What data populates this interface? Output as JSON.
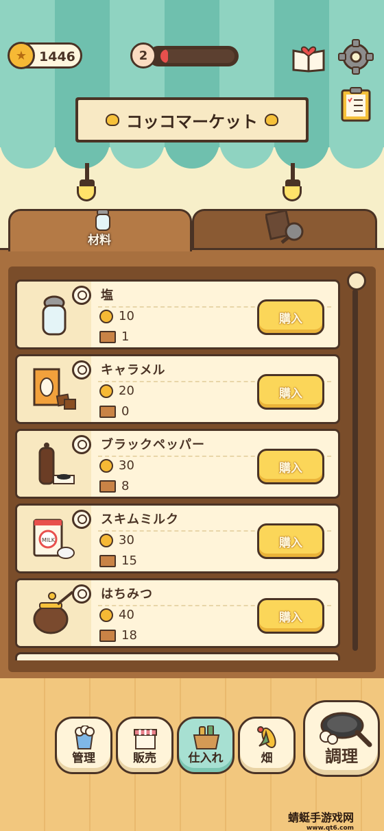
{
  "hud": {
    "coins": "1446",
    "level": "2",
    "level_progress": 0.1
  },
  "sign": {
    "title": "コッコマーケット"
  },
  "tabs": [
    {
      "label": "材料",
      "icon": "salt-jar-icon",
      "active": true
    },
    {
      "label": "",
      "icon": "newspaper-pan-icon",
      "active": false
    }
  ],
  "items": [
    {
      "name": "塩",
      "price": "10",
      "stock": "1",
      "buy": "購入",
      "icon": "salt-jar-icon"
    },
    {
      "name": "キャラメル",
      "price": "20",
      "stock": "0",
      "buy": "購入",
      "icon": "caramel-box-icon"
    },
    {
      "name": "ブラックペッパー",
      "price": "30",
      "stock": "8",
      "buy": "購入",
      "icon": "pepper-mill-icon"
    },
    {
      "name": "スキムミルク",
      "price": "30",
      "stock": "15",
      "buy": "購入",
      "icon": "milk-can-icon"
    },
    {
      "name": "はちみつ",
      "price": "40",
      "stock": "18",
      "buy": "購入",
      "icon": "honey-pot-icon"
    }
  ],
  "nav": [
    {
      "label": "管理",
      "icon": "popcorn-cup-icon",
      "active": false
    },
    {
      "label": "販売",
      "icon": "shop-stall-icon",
      "active": false
    },
    {
      "label": "仕入れ",
      "icon": "crate-icon",
      "active": true
    },
    {
      "label": "畑",
      "icon": "corn-icon",
      "active": false
    }
  ],
  "cook": {
    "label": "調理",
    "icon": "frying-pan-icon"
  },
  "watermark": {
    "text": "蜻蜓手游戏网",
    "url": "www.qt6.com"
  },
  "colors": {
    "awning_light": "#8fd3c1",
    "awning_dark": "#6fc0ae",
    "wood": "#a8703f",
    "outline": "#4a3325",
    "buy_button": "#fbd659",
    "level_fill": "#e8504d"
  }
}
